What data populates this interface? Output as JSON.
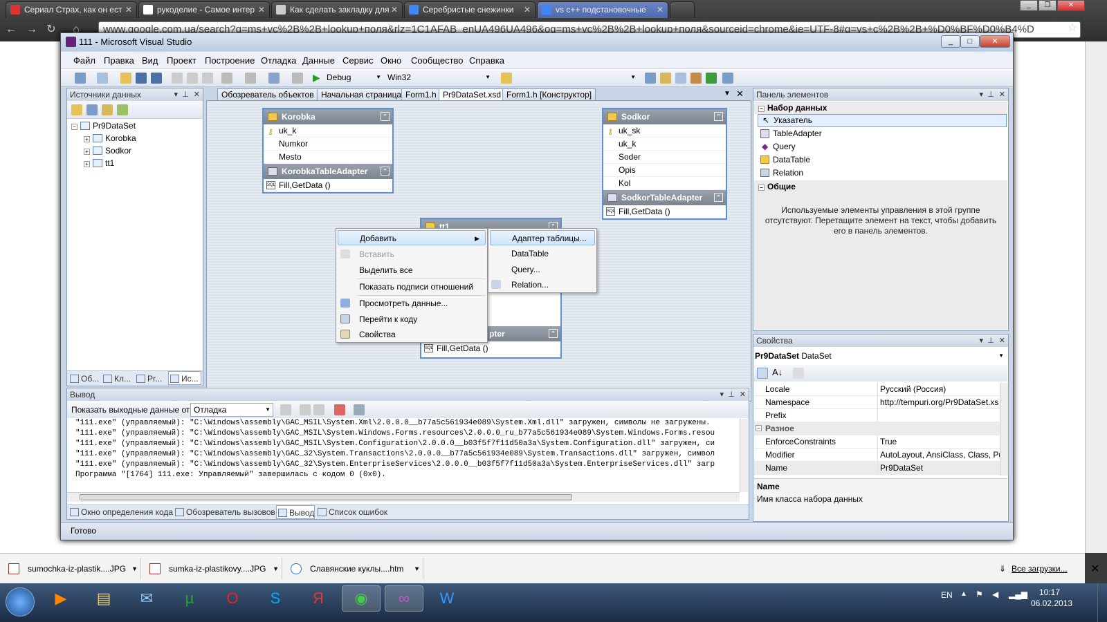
{
  "browser": {
    "tabs": [
      {
        "label": "Сериал Страх, как он ест"
      },
      {
        "label": "рукоделие - Самое интер"
      },
      {
        "label": "Как сделать закладку для"
      },
      {
        "label": "Серебристые снежинки"
      },
      {
        "label": "vs c++ подстановочные"
      }
    ],
    "url": "www.google.com.ua/search?q=ms+vc%2B%2B+lookup+поля&rlz=1C1AFAB_enUA496UA496&oq=ms+vc%2B%2B+lookup+поля&sourceid=chrome&ie=UTF-8#q=vs+c%2B%2B+%D0%BF%D0%B4%D"
  },
  "vs": {
    "title": "111 - Microsoft Visual Studio",
    "menu": [
      "Файл",
      "Правка",
      "Вид",
      "Проект",
      "Построение",
      "Отладка",
      "Данные",
      "Сервис",
      "Окно",
      "Сообщество",
      "Справка"
    ],
    "toolbar": {
      "config": "Debug",
      "platform": "Win32"
    },
    "datasources": {
      "title": "Источники данных",
      "root": "Pr9DataSet",
      "items": [
        "Korobka",
        "Sodkor",
        "tt1"
      ],
      "bottom_tabs": [
        "Об...",
        "Кл...",
        "Pr...",
        "Ис..."
      ]
    },
    "doc_tabs": [
      "Обозреватель объектов",
      "Начальная страница",
      "Form1.h",
      "Pr9DataSet.xsd",
      "Form1.h [Конструктор]"
    ],
    "tables": {
      "korobka": {
        "name": "Korobka",
        "cols": [
          "uk_k",
          "Numkor",
          "Mesto"
        ],
        "adapter": "KorobkaTableAdapter",
        "method": "Fill,GetData ()"
      },
      "sodkor": {
        "name": "Sodkor",
        "cols": [
          "uk_sk",
          "uk_k",
          "Soder",
          "Opis",
          "Kol"
        ],
        "adapter": "SodkorTableAdapter",
        "method": "Fill,GetData ()"
      },
      "tt1": {
        "name": "tt1",
        "adapter_partial": "pter",
        "method": "Fill,GetData ()"
      }
    },
    "context_menu": {
      "items": [
        "Добавить",
        "Вставить",
        "Выделить все",
        "Показать подписи отношений",
        "Просмотреть данные...",
        "Перейти к коду",
        "Свойства"
      ],
      "submenu": [
        "Адаптер таблицы...",
        "DataTable",
        "Query...",
        "Relation..."
      ]
    },
    "toolbox": {
      "title": "Панель элементов",
      "group1": "Набор данных",
      "items": [
        "Указатель",
        "TableAdapter",
        "Query",
        "DataTable",
        "Relation"
      ],
      "group2": "Общие",
      "empty_msg": "Используемые элементы управления в этой группе отсутствуют. Перетащите элемент на текст, чтобы добавить его в панель элементов."
    },
    "properties": {
      "title": "Свойства",
      "object": "Pr9DataSet",
      "object_type": "DataSet",
      "rows": [
        {
          "name": "Locale",
          "value": "Русский (Россия)"
        },
        {
          "name": "Namespace",
          "value": "http://tempuri.org/Pr9DataSet.xs"
        },
        {
          "name": "Prefix",
          "value": ""
        },
        {
          "category": "Разное"
        },
        {
          "name": "EnforceConstraints",
          "value": "True"
        },
        {
          "name": "Modifier",
          "value": "AutoLayout, AnsiClass, Class, Pul"
        },
        {
          "name": "Name",
          "value": "Pr9DataSet"
        }
      ],
      "desc_title": "Name",
      "desc_text": "Имя класса набора данных"
    },
    "output": {
      "title": "Вывод",
      "show_label": "Показать выходные данные от:",
      "source": "Отладка",
      "lines": [
        "\"111.exe\" (управляемый): \"C:\\Windows\\assembly\\GAC_MSIL\\System.Xml\\2.0.0.0__b77a5c561934e089\\System.Xml.dll\" загружен, символы не загружены.",
        "\"111.exe\" (управляемый): \"C:\\Windows\\assembly\\GAC_MSIL\\System.Windows.Forms.resources\\2.0.0.0_ru_b77a5c561934e089\\System.Windows.Forms.resou",
        "\"111.exe\" (управляемый): \"C:\\Windows\\assembly\\GAC_MSIL\\System.Configuration\\2.0.0.0__b03f5f7f11d50a3a\\System.Configuration.dll\" загружен, си",
        "\"111.exe\" (управляемый): \"C:\\Windows\\assembly\\GAC_32\\System.Transactions\\2.0.0.0__b77a5c561934e089\\System.Transactions.dll\" загружен, символ",
        "\"111.exe\" (управляемый): \"C:\\Windows\\assembly\\GAC_32\\System.EnterpriseServices\\2.0.0.0__b03f5f7f11d50a3a\\System.EnterpriseServices.dll\" загр",
        "Программа \"[1764] 111.exe: Управляемый\" завершилась с кодом 0 (0x0)."
      ],
      "bottom_tabs": [
        "Окно определения кода",
        "Обозреватель вызовов",
        "Вывод",
        "Список ошибок"
      ]
    },
    "status": "Готово"
  },
  "downloads": {
    "items": [
      "sumochka-iz-plastik....JPG",
      "sumka-iz-plastikovy....JPG",
      "Славянские куклы....htm"
    ],
    "all_label": "Все загрузки..."
  },
  "taskbar": {
    "lang": "EN",
    "time": "10:17",
    "date": "06.02.2013"
  }
}
